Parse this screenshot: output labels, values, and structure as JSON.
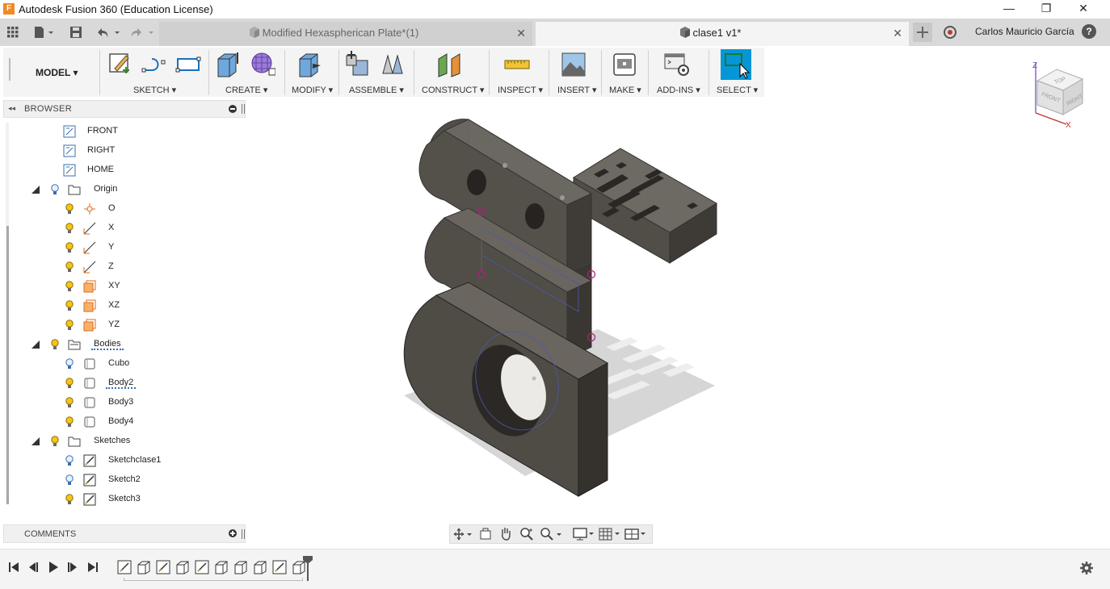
{
  "window": {
    "title": "Autodesk Fusion 360 (Education License)",
    "logo_letter": "F",
    "minimize": "—",
    "maximize": "❐",
    "close": "✕"
  },
  "tabs": [
    {
      "label": "Modified Hexaspherican Plate*(1)",
      "close": "✕",
      "active": false
    },
    {
      "label": "clase1 v1*",
      "close": "✕",
      "active": true
    }
  ],
  "user": {
    "name": "Carlos Mauricio García"
  },
  "toolbar": {
    "workspace": "MODEL ▾",
    "groups": [
      {
        "label": "SKETCH ▾"
      },
      {
        "label": "CREATE ▾"
      },
      {
        "label": "MODIFY ▾"
      },
      {
        "label": "ASSEMBLE ▾"
      },
      {
        "label": "CONSTRUCT ▾"
      },
      {
        "label": "INSPECT ▾"
      },
      {
        "label": "INSERT ▾"
      },
      {
        "label": "MAKE ▾"
      },
      {
        "label": "ADD-INS ▾"
      },
      {
        "label": "SELECT ▾"
      }
    ]
  },
  "browser": {
    "title": "BROWSER",
    "collapse_glyph": "◂◂",
    "named_views": [
      {
        "label": "FRONT"
      },
      {
        "label": "RIGHT"
      },
      {
        "label": "HOME"
      }
    ],
    "origin": {
      "label": "Origin",
      "items": [
        {
          "label": "O",
          "icon": "origin-point-icon"
        },
        {
          "label": "X",
          "icon": "axis-icon"
        },
        {
          "label": "Y",
          "icon": "axis-icon"
        },
        {
          "label": "Z",
          "icon": "axis-icon"
        },
        {
          "label": "XY",
          "icon": "plane-icon"
        },
        {
          "label": "XZ",
          "icon": "plane-icon"
        },
        {
          "label": "YZ",
          "icon": "plane-icon"
        }
      ]
    },
    "bodies": {
      "label": "Bodies",
      "items": [
        {
          "label": "Cubo"
        },
        {
          "label": "Body2"
        },
        {
          "label": "Body3"
        },
        {
          "label": "Body4"
        }
      ]
    },
    "sketches": {
      "label": "Sketches",
      "items": [
        {
          "label": "Sketchclase1"
        },
        {
          "label": "Sketch2"
        },
        {
          "label": "Sketch3"
        }
      ]
    }
  },
  "comments": {
    "title": "COMMENTS"
  },
  "viewcube": {
    "axis_z": "Z",
    "axis_x": "X",
    "face_top": "TOP",
    "face_front": "FRONT",
    "face_right": "RIGHT"
  },
  "colors": {
    "accent_blue": "#0696d7",
    "bulb_yellow": "#f5c518",
    "bulb_off": "#cfe3f5",
    "sketch_magenta": "#b0207a",
    "model_dark": "#4a4640",
    "model_top": "#6b6760",
    "shadow": "#d4d4d4"
  }
}
